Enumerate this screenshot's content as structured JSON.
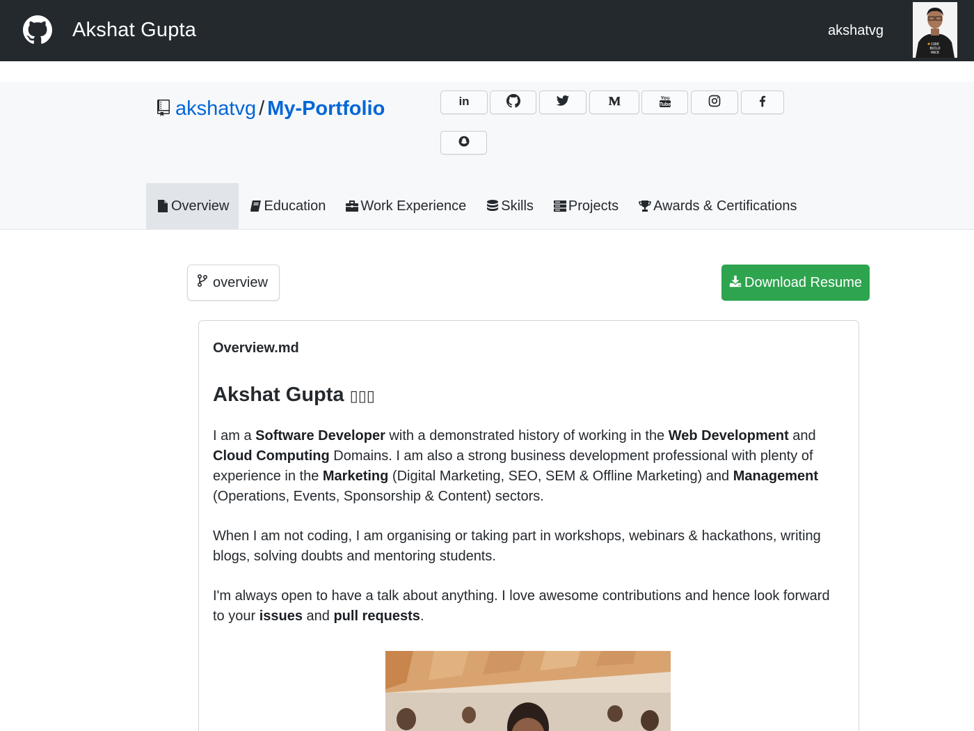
{
  "topbar": {
    "brand": "Akshat Gupta",
    "username": "akshatvg",
    "logo_icon": "github-icon",
    "avatar_icon": "user-avatar"
  },
  "repo": {
    "owner": "akshatvg",
    "separator": "/",
    "name": "My-Portfolio",
    "icon": "repo-icon"
  },
  "social": [
    {
      "name": "linkedin",
      "icon": "linkedin-icon"
    },
    {
      "name": "github",
      "icon": "github-icon"
    },
    {
      "name": "twitter",
      "icon": "twitter-icon"
    },
    {
      "name": "medium",
      "icon": "medium-icon"
    },
    {
      "name": "youtube",
      "icon": "youtube-icon"
    },
    {
      "name": "instagram",
      "icon": "instagram-icon"
    },
    {
      "name": "facebook",
      "icon": "facebook-icon"
    },
    {
      "name": "snapchat",
      "icon": "snapchat-icon"
    }
  ],
  "tabs": [
    {
      "label": "Overview",
      "icon": "file-icon",
      "active": true
    },
    {
      "label": "Education",
      "icon": "book-icon",
      "active": false
    },
    {
      "label": "Work Experience",
      "icon": "briefcase-icon",
      "active": false
    },
    {
      "label": "Skills",
      "icon": "database-icon",
      "active": false
    },
    {
      "label": "Projects",
      "icon": "server-icon",
      "active": false
    },
    {
      "label": "Awards & Certifications",
      "icon": "trophy-icon",
      "active": false
    }
  ],
  "branch": {
    "label": "overview",
    "icon": "git-branch-icon"
  },
  "download": {
    "label": "Download Resume",
    "icon": "download-icon"
  },
  "readme": {
    "filename": "Overview.md",
    "heading": "Akshat Gupta",
    "heading_glyphs": "▯▯▯",
    "p1": {
      "t1": "I am a ",
      "b1": "Software Developer",
      "t2": " with a demonstrated history of working in the ",
      "b2": "Web Development",
      "t3": " and ",
      "b3": "Cloud Computing",
      "t4": " Domains. I am also a strong business development professional with plenty of experience in the ",
      "b4": "Marketing",
      "t5": " (Digital Marketing, SEO, SEM & Offline Marketing) and ",
      "b5": "Management",
      "t6": " (Operations, Events, Sponsorship & Content) sectors."
    },
    "p2": "When I am not coding, I am organising or taking part in workshops, webinars & hackathons, writing blogs, solving doubts and mentoring students.",
    "p3": {
      "t1": "I'm always open to have a talk about anything. I love awesome contributions and hence look forward to your ",
      "b1": "issues",
      "t2": " and ",
      "b2": "pull requests",
      "t3": "."
    },
    "photo": "profile-photo"
  },
  "colors": {
    "topbar": "#24292e",
    "link": "#0366d6",
    "download_button": "#2ea44f",
    "tab_active": "#e1e4e8",
    "header_bg": "#f6f8fa"
  }
}
